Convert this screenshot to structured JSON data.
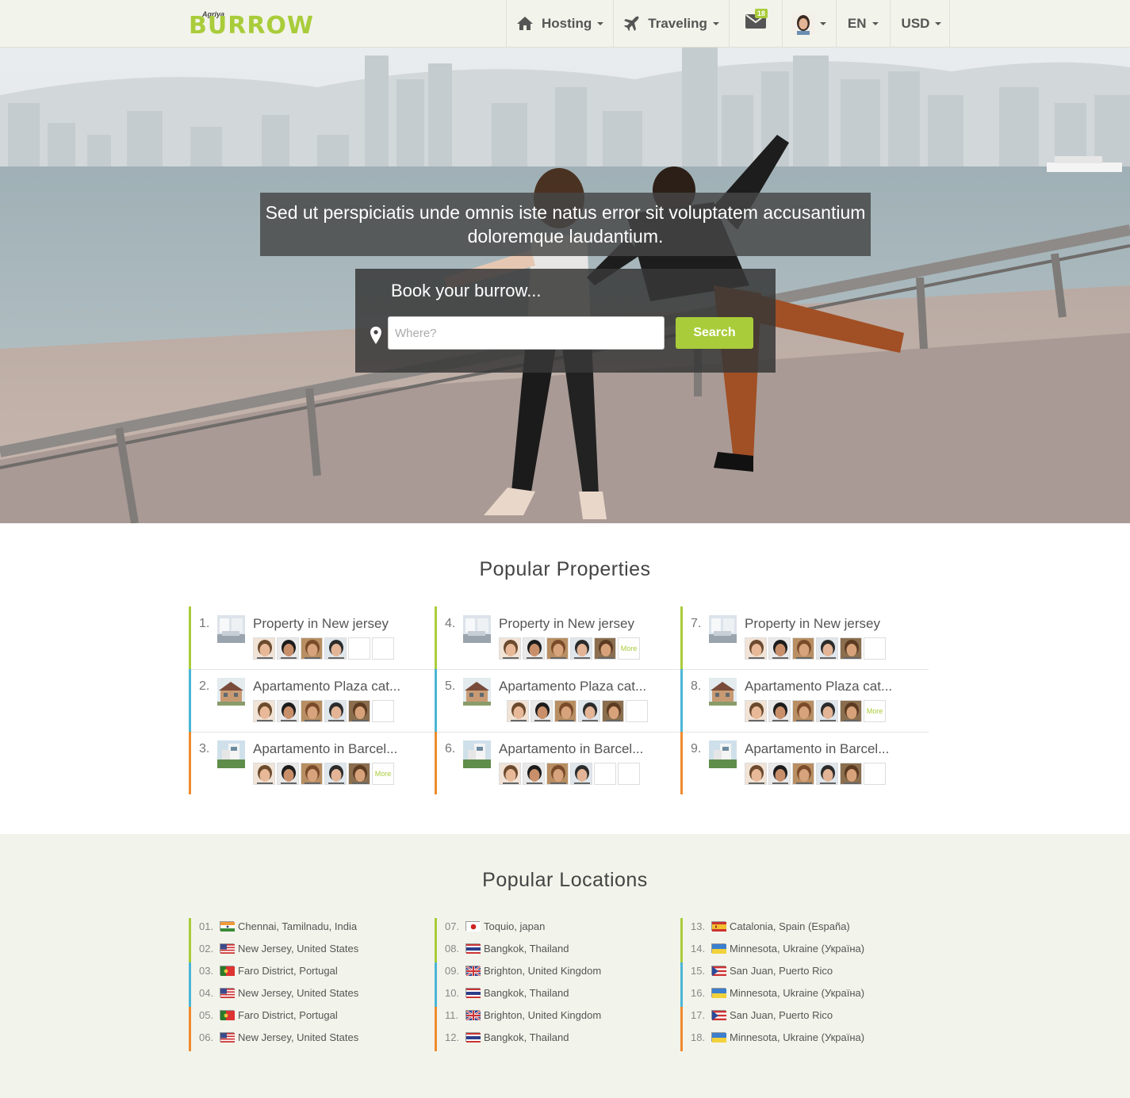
{
  "brand": {
    "logo_sub": "Agriya",
    "logo_word": "BURROW",
    "accent": "#a9cc3a"
  },
  "nav": {
    "hosting": "Hosting",
    "traveling": "Traveling",
    "messages_badge": "18",
    "language": "EN",
    "currency": "USD"
  },
  "hero": {
    "tagline": "Sed ut perspiciatis unde omnis iste natus error sit voluptatem accusantium doloremque laudantium.",
    "booking_title": "Book your burrow...",
    "where_placeholder": "Where?",
    "search_label": "Search"
  },
  "popular_properties": {
    "title": "Popular Properties",
    "more_label": "More",
    "bar_colors": [
      "#a9cc3a",
      "#4ab5d6",
      "#ef8a2e"
    ],
    "items": [
      {
        "num": "1.",
        "name": "Property in New jersey",
        "thumb": "interior",
        "avatars": 4,
        "empty": 2,
        "more": false
      },
      {
        "num": "2.",
        "name": "Apartamento Plaza cat...",
        "thumb": "house",
        "avatars": 5,
        "empty": 1,
        "more": false
      },
      {
        "num": "3.",
        "name": "Apartamento in Barcel...",
        "thumb": "villa",
        "avatars": 5,
        "empty": 0,
        "more": true
      },
      {
        "num": "4.",
        "name": "Property in New jersey",
        "thumb": "interior",
        "avatars": 5,
        "empty": 0,
        "more": true
      },
      {
        "num": "5.",
        "name": "Apartamento Plaza cat...",
        "thumb": "house",
        "avatars": 5,
        "empty": 1,
        "more": false,
        "avatar_offset": true
      },
      {
        "num": "6.",
        "name": "Apartamento in Barcel...",
        "thumb": "villa",
        "avatars": 4,
        "empty": 2,
        "more": false
      },
      {
        "num": "7.",
        "name": "Property in New jersey",
        "thumb": "interior",
        "avatars": 5,
        "empty": 1,
        "more": false
      },
      {
        "num": "8.",
        "name": "Apartamento Plaza cat...",
        "thumb": "house",
        "avatars": 5,
        "empty": 0,
        "more": true
      },
      {
        "num": "9.",
        "name": "Apartamento in Barcel...",
        "thumb": "villa",
        "avatars": 5,
        "empty": 1,
        "more": false
      }
    ]
  },
  "popular_locations": {
    "title": "Popular Locations",
    "items": [
      {
        "num": "01.",
        "text": "Chennai, Tamilnadu, India",
        "flag": "india"
      },
      {
        "num": "02.",
        "text": "New Jersey, United States",
        "flag": "usa"
      },
      {
        "num": "03.",
        "text": "Faro District, Portugal",
        "flag": "portugal"
      },
      {
        "num": "04.",
        "text": "New Jersey, United States",
        "flag": "usa"
      },
      {
        "num": "05.",
        "text": "Faro District, Portugal",
        "flag": "portugal"
      },
      {
        "num": "06.",
        "text": "New Jersey, United States",
        "flag": "usa"
      },
      {
        "num": "07.",
        "text": "Toquio, japan",
        "flag": "japan"
      },
      {
        "num": "08.",
        "text": "Bangkok, Thailand",
        "flag": "thailand"
      },
      {
        "num": "09.",
        "text": "Brighton, United Kingdom",
        "flag": "uk"
      },
      {
        "num": "10.",
        "text": "Bangkok, Thailand",
        "flag": "thailand"
      },
      {
        "num": "11.",
        "text": "Brighton, United Kingdom",
        "flag": "uk"
      },
      {
        "num": "12.",
        "text": "Bangkok, Thailand",
        "flag": "thailand"
      },
      {
        "num": "13.",
        "text": "Catalonia, Spain (España)",
        "flag": "spain"
      },
      {
        "num": "14.",
        "text": "Minnesota, Ukraine (Україна)",
        "flag": "ukraine"
      },
      {
        "num": "15.",
        "text": "San Juan, Puerto Rico",
        "flag": "puerto-rico"
      },
      {
        "num": "16.",
        "text": "Minnesota, Ukraine (Україна)",
        "flag": "ukraine"
      },
      {
        "num": "17.",
        "text": "San Juan, Puerto Rico",
        "flag": "puerto-rico"
      },
      {
        "num": "18.",
        "text": "Minnesota, Ukraine (Україна)",
        "flag": "ukraine"
      }
    ]
  }
}
